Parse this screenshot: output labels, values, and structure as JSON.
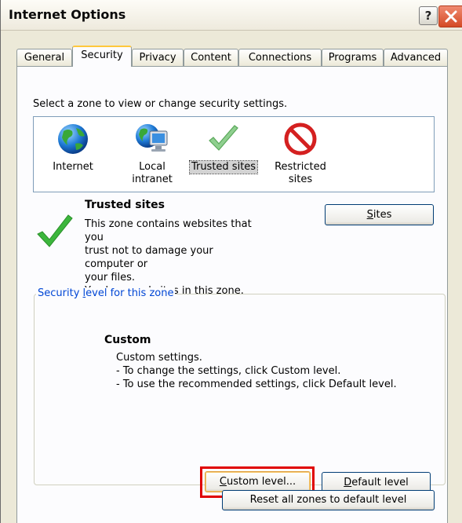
{
  "window": {
    "title": "Internet Options"
  },
  "tabs": [
    {
      "label": "General"
    },
    {
      "label": "Security"
    },
    {
      "label": "Privacy"
    },
    {
      "label": "Content"
    },
    {
      "label": "Connections"
    },
    {
      "label": "Programs"
    },
    {
      "label": "Advanced"
    }
  ],
  "security": {
    "zone_instruction": "Select a zone to view or change security settings.",
    "zones": [
      {
        "line1": "Internet",
        "line2": "",
        "icon": "globe-icon"
      },
      {
        "line1": "Local",
        "line2": "intranet",
        "icon": "computer-globe-icon"
      },
      {
        "line1": "Trusted sites",
        "line2": "",
        "icon": "checkmark-icon"
      },
      {
        "line1": "Restricted",
        "line2": "sites",
        "icon": "no-entry-icon"
      }
    ],
    "selected_zone": "Trusted sites",
    "description": {
      "title": "Trusted sites",
      "line1": "This zone contains websites that you",
      "line2": "trust not to damage your computer or",
      "line3": "your files.",
      "line4": "You have websites in this zone."
    },
    "sites_button": {
      "mnemonic": "S",
      "rest": "ites"
    },
    "level_group": {
      "legend_pre": "Security ",
      "legend_mnemonic": "l",
      "legend_rest": "evel for this zone",
      "title": "Custom",
      "line1": "Custom settings.",
      "line2": "- To change the settings, click Custom level.",
      "line3": "- To use the recommended settings, click Default level."
    },
    "custom_level_button": {
      "mnemonic": "C",
      "rest": "ustom level..."
    },
    "default_level_button": {
      "mnemonic": "D",
      "rest": "efault level"
    },
    "reset_button": {
      "pre": "Reset all zones to default level"
    }
  },
  "colors": {
    "tab_active_accent": "#ffc83c",
    "legend_blue": "#0046d5",
    "highlight_red": "#e00000",
    "close_red": "#d44a25"
  }
}
